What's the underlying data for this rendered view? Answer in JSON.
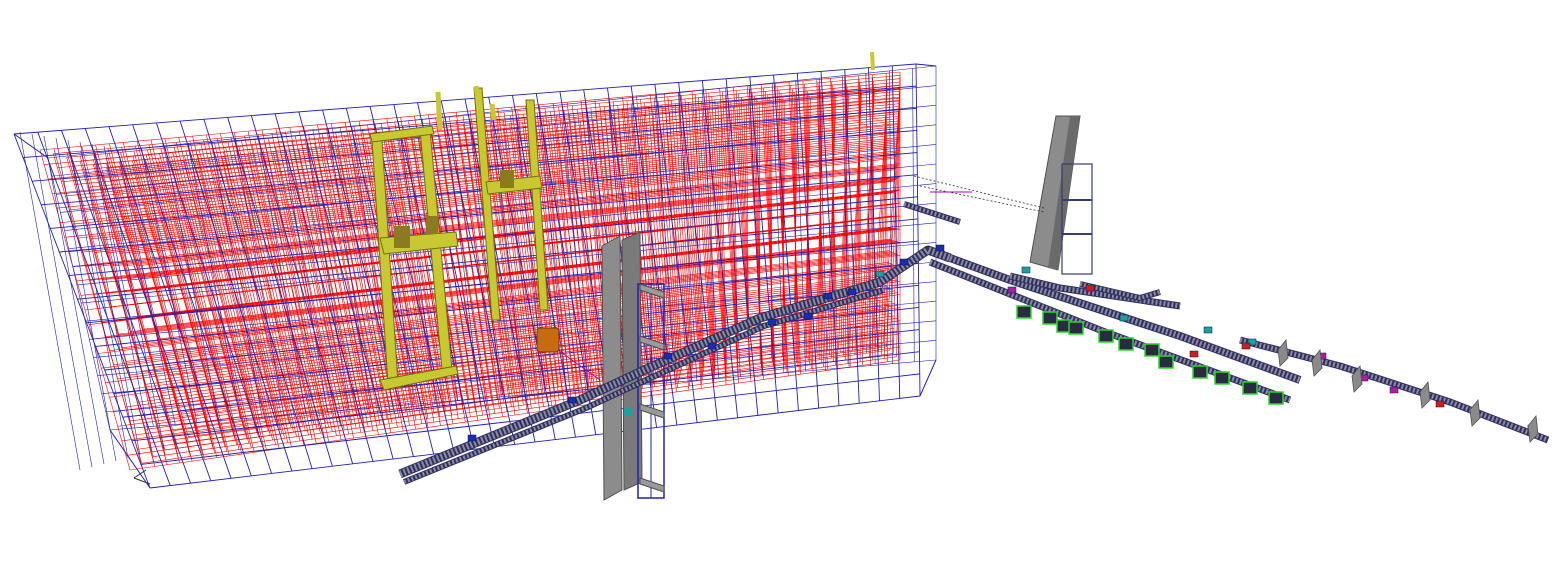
{
  "viewport": {
    "background": "#ffffff",
    "colors": {
      "rack_outline": "#1f1fb4",
      "rack_bins": "#ff0000",
      "crane": "#c8c832",
      "lift_tower": "#808080",
      "conveyor": "#303060",
      "conveyor_light": "#8a8aa0",
      "load_blue": "#1a2bb8",
      "load_teal": "#1ca0a0",
      "load_red": "#d01c1c",
      "load_magenta": "#b01ca0",
      "station_green": "#2ad82a",
      "pallet_orange": "#c86a10",
      "link_purple": "#a000c0"
    }
  },
  "scene": {
    "objects": [
      "rack-structure",
      "stacker-crane",
      "lift-tower",
      "conveyor-line",
      "sorting-stations",
      "pick-stations"
    ]
  }
}
